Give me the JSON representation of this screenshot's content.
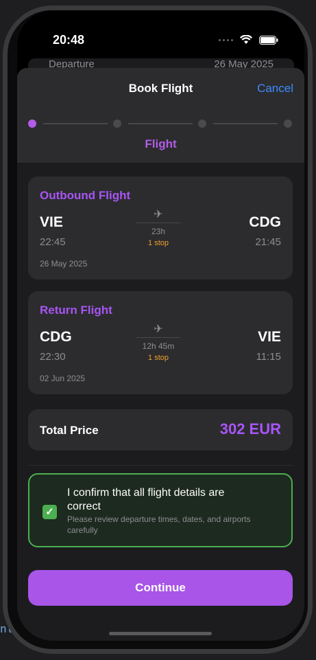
{
  "status_bar": {
    "time": "20:48"
  },
  "behind_sheet": {
    "label": "Departure",
    "value": "26 May 2025"
  },
  "header": {
    "title": "Book Flight",
    "cancel": "Cancel"
  },
  "stepper": {
    "current_label": "Flight",
    "steps_total": 4,
    "current_step": 1
  },
  "outbound": {
    "title": "Outbound Flight",
    "from_code": "VIE",
    "from_time": "22:45",
    "to_code": "CDG",
    "to_time": "21:45",
    "duration": "23h",
    "stops": "1 stop",
    "date": "26 May 2025"
  },
  "return_flight": {
    "title": "Return Flight",
    "from_code": "CDG",
    "from_time": "22:30",
    "to_code": "VIE",
    "to_time": "11:15",
    "duration": "12h 45m",
    "stops": "1 stop",
    "date": "02 Jun 2025"
  },
  "price": {
    "label": "Total Price",
    "value": "302 EUR"
  },
  "confirm": {
    "checked": true,
    "main": "I confirm that all flight details are correct",
    "sub": "Please review departure times, dates, and airports carefully"
  },
  "continue_label": "Continue",
  "colors": {
    "accent": "#a855f7",
    "success": "#4caf50",
    "link": "#3d8bfd",
    "stop": "#f0a030"
  }
}
